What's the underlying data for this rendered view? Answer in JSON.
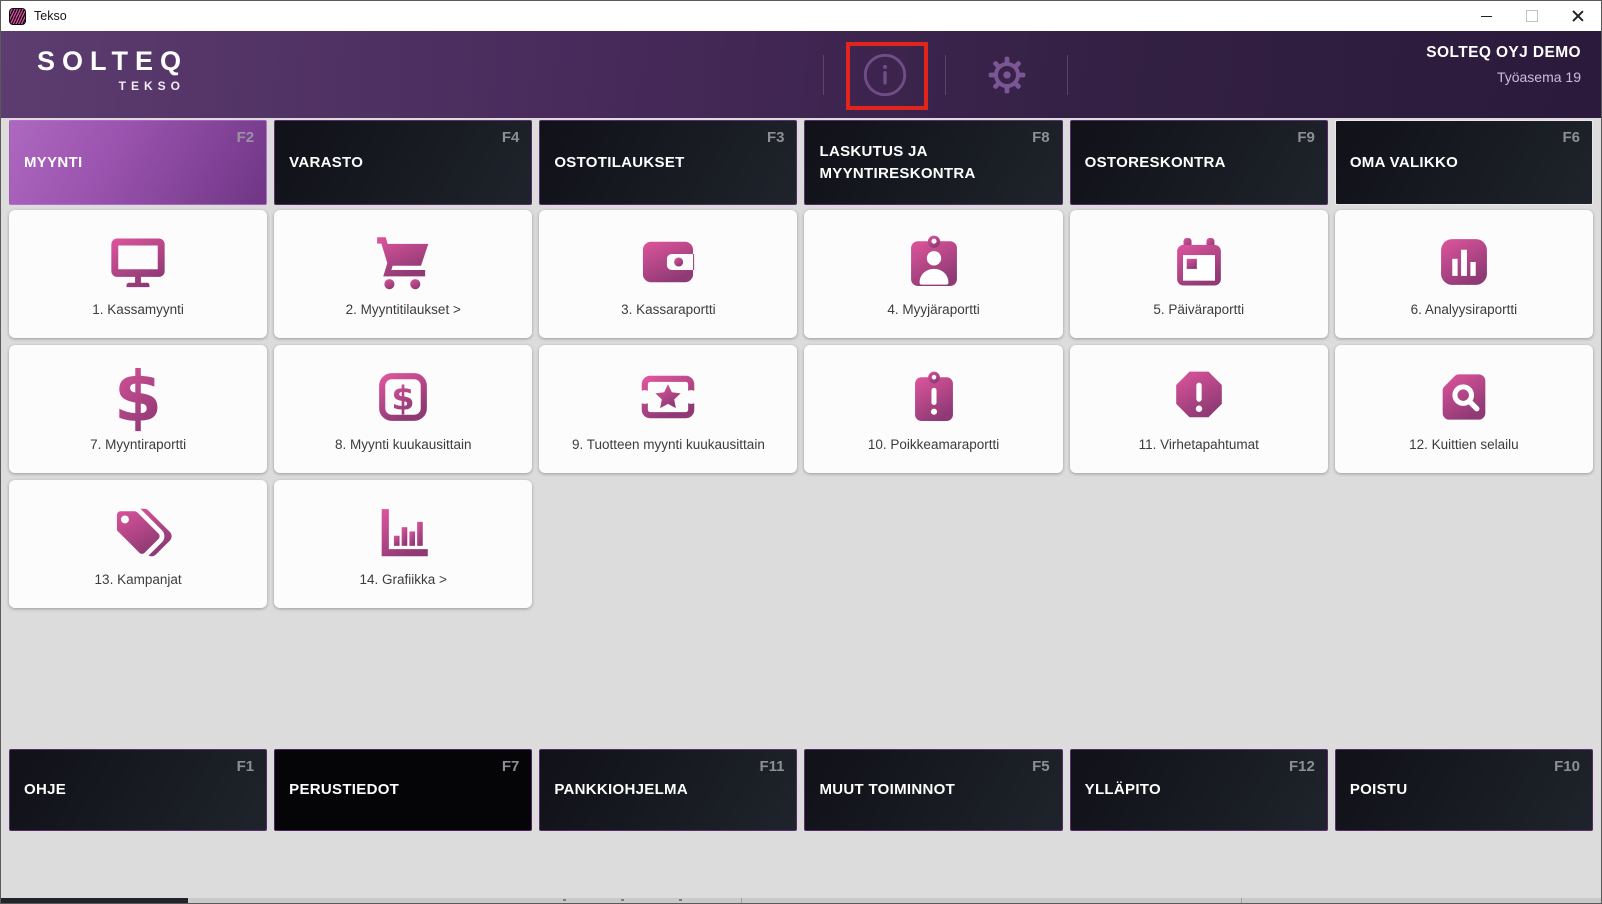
{
  "window": {
    "title": "Tekso"
  },
  "header": {
    "logo_primary": "SOLTEQ",
    "logo_secondary": "TEKSO",
    "company": "SOLTEQ OYJ DEMO",
    "workstation": "Työasema 19",
    "icons": [
      {
        "name": "info-icon",
        "highlighted": true
      },
      {
        "name": "gear-icon",
        "highlighted": false
      }
    ]
  },
  "colors": {
    "header_gradient_start": "#5d3c70",
    "header_gradient_end": "#2b1a3b",
    "active_tab_start": "#ad68c0",
    "active_tab_end": "#6f3685",
    "accent_pink_top": "#de559c",
    "accent_pink_bottom": "#8f3a75",
    "highlight_red": "#e1251b"
  },
  "tabs": [
    {
      "label": "MYYNTI",
      "fkey": "F2",
      "active": true
    },
    {
      "label": "VARASTO",
      "fkey": "F4"
    },
    {
      "label": "OSTOTILAUKSET",
      "fkey": "F3"
    },
    {
      "label": "LASKUTUS JA MYYNTIRESKONTRA",
      "fkey": "F8"
    },
    {
      "label": "OSTORESKONTRA",
      "fkey": "F9"
    },
    {
      "label": "OMA VALIKKO",
      "fkey": "F6",
      "light_border": true
    }
  ],
  "tiles": [
    {
      "label": "1. Kassamyynti",
      "icon": "monitor-icon"
    },
    {
      "label": "2. Myyntitilaukset >",
      "icon": "cart-icon"
    },
    {
      "label": "3. Kassaraportti",
      "icon": "wallet-icon"
    },
    {
      "label": "4. Myyjäraportti",
      "icon": "id-badge-icon"
    },
    {
      "label": "5. Päiväraportti",
      "icon": "calendar-icon"
    },
    {
      "label": "6. Analyysiraportti",
      "icon": "chart-square-icon"
    },
    {
      "label": "7. Myyntiraportti",
      "icon": "dollar-icon"
    },
    {
      "label": "8. Myynti kuukausittain",
      "icon": "bill-dollar-icon"
    },
    {
      "label": "9. Tuotteen myynti kuukausittain",
      "icon": "ticket-star-icon"
    },
    {
      "label": "10. Poikkeamaraportti",
      "icon": "clipboard-alert-icon"
    },
    {
      "label": "11. Virhetapahtumat",
      "icon": "octagon-alert-icon"
    },
    {
      "label": "12. Kuittien selailu",
      "icon": "receipt-search-icon"
    },
    {
      "label": "13. Kampanjat",
      "icon": "tags-icon"
    },
    {
      "label": "14. Grafiikka >",
      "icon": "bar-graph-icon"
    }
  ],
  "bottom_buttons": [
    {
      "label": "OHJE",
      "fkey": "F1"
    },
    {
      "label": "PERUSTIEDOT",
      "fkey": "F7",
      "variant": "black"
    },
    {
      "label": "PANKKIOHJELMA",
      "fkey": "F11"
    },
    {
      "label": "MUUT TOIMINNOT",
      "fkey": "F5"
    },
    {
      "label": "YLLÄPITO",
      "fkey": "F12"
    },
    {
      "label": "POISTU",
      "fkey": "F10"
    }
  ]
}
